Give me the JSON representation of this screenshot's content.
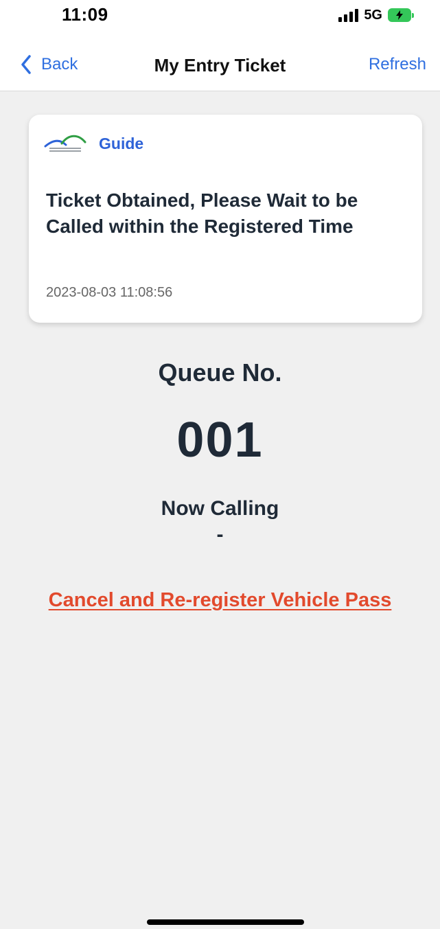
{
  "status_bar": {
    "time": "11:09",
    "network": "5G"
  },
  "nav": {
    "back_label": "Back",
    "title": "My Entry Ticket",
    "refresh_label": "Refresh"
  },
  "card": {
    "label": "Guide",
    "title": "Ticket Obtained, Please Wait to be Called within the Registered Time",
    "timestamp": "2023-08-03 11:08:56"
  },
  "queue": {
    "label": "Queue No.",
    "number": "001",
    "calling_label": "Now Calling",
    "calling_value": "-"
  },
  "cancel_link": "Cancel and Re-register Vehicle Pass",
  "colors": {
    "accent": "#2f6fe0",
    "link_red": "#e24a2d",
    "battery": "#34c759",
    "text_dark": "#1f2a37"
  }
}
